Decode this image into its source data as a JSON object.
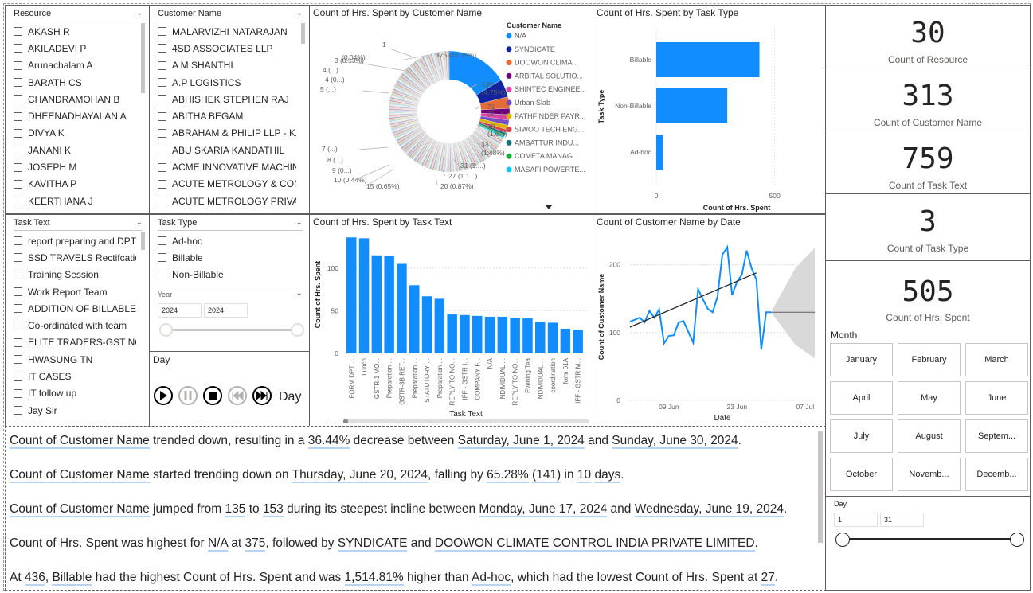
{
  "slicers": {
    "resource": {
      "title": "Resource",
      "items": [
        "AKASH R",
        "AKILADEVI P",
        "Arunachalam A",
        "BARATH CS",
        "CHANDRAMOHAN B",
        "DHEENADHAYALAN A",
        "DIVYA K",
        "JANANI K",
        "JOSEPH M",
        "KAVITHA P",
        "KEERTHANA J"
      ]
    },
    "customer": {
      "title": "Customer Name",
      "items": [
        "MALARVIZHI NATARAJAN",
        "4SD ASSOCIATES LLP",
        "A M SHANTHI",
        "A.P LOGISTICS",
        "ABHISHEK STEPHEN RAJ",
        "ABITHA BEGAM",
        "ABRAHAM & PHILIP LLP - KA",
        "ABU SKARIA KANDATHIL",
        "ACME INNOVATIVE MACHININ...",
        "ACUTE METROLOGY & CONSU...",
        "ACUTE METROLOGY PRIVATE L..."
      ]
    },
    "task_text": {
      "title": "Task Text",
      "items": [
        "report preparing and DPT ...",
        "SSD TRAVELS Rectifcation",
        "Training Session",
        "Work Report Team",
        "ADDITION OF BILLABLE JO...",
        "Co-ordinated with team",
        "ELITE TRADERS-GST NOTI...",
        "HWASUNG TN",
        "IT CASES",
        "IT follow up",
        "Jay Sir"
      ]
    },
    "task_type": {
      "title": "Task Type",
      "items": [
        "Ad-hoc",
        "Billable",
        "Non-Billable"
      ]
    },
    "year": {
      "title": "Year",
      "from": "2024",
      "to": "2024"
    },
    "day_play": {
      "title": "Day",
      "label": "Day"
    },
    "month": {
      "title": "Month",
      "items": [
        "January",
        "February",
        "March",
        "April",
        "May",
        "June",
        "July",
        "August",
        "Septem...",
        "October",
        "Novemb...",
        "Decemb..."
      ]
    },
    "day_range": {
      "title": "Day",
      "from": "1",
      "to": "31"
    }
  },
  "kpis": [
    {
      "value": "30",
      "label": "Count of Resource"
    },
    {
      "value": "313",
      "label": "Count of Customer Name"
    },
    {
      "value": "759",
      "label": "Count of Task Text"
    },
    {
      "value": "3",
      "label": "Count of Task Type"
    },
    {
      "value": "505",
      "label": "Count of Hrs. Spent"
    }
  ],
  "donut": {
    "title": "Count of Hrs. Spent by Customer Name",
    "legend_title": "Customer Name",
    "legend": [
      {
        "name": "N/A",
        "color": "#118DFF"
      },
      {
        "name": "SYNDICATE",
        "color": "#12239E"
      },
      {
        "name": "DOOWON CLIMA...",
        "color": "#E66C37"
      },
      {
        "name": "ARBITAL SOLUTIO...",
        "color": "#6B007B"
      },
      {
        "name": "SHINTEC ENGINEE...",
        "color": "#E044A7"
      },
      {
        "name": "Urban Slab",
        "color": "#744EC2"
      },
      {
        "name": "PATHFINDER PAYR...",
        "color": "#D9B300"
      },
      {
        "name": "SIWOO TECH ENG...",
        "color": "#D64550"
      },
      {
        "name": "AMBATTUR INDU...",
        "color": "#197278"
      },
      {
        "name": "COMETA MANAG...",
        "color": "#1AAB40"
      },
      {
        "name": "MASAFI POWERTE...",
        "color": "#15C6F4"
      }
    ],
    "labels": [
      "375 (16.35%)",
      "109",
      "(4.75%)",
      "71",
      "(3....)",
      "38",
      "(1.6...)",
      "34",
      "(1.48%)",
      "31 (1....)",
      "27 (1.1...)",
      "20 (0.87%)",
      "15 (0.65%)",
      "10 (0.44%)",
      "9 (0...)",
      "8 (...)",
      "7 (...)",
      "5 (...)",
      "4 (0...)",
      "4 (...)",
      "3 (0.13%)",
      "(0.04%)",
      "1"
    ]
  },
  "task_type_chart": {
    "title": "Count of Hrs. Spent by Task Type",
    "ylabel": "Task Type",
    "xlabel": "Count of Hrs. Spent",
    "ticks": [
      "0",
      "500"
    ]
  },
  "task_text_chart": {
    "title": "Count of Hrs. Spent by Task Text",
    "ylabel": "Count of Hrs. Spent",
    "xlabel": "Task Text",
    "yticks": [
      "0",
      "50",
      "100"
    ]
  },
  "date_chart": {
    "title": "Count of Customer Name by Date",
    "ylabel": "Count of Customer Name",
    "xlabel": "Date",
    "yticks": [
      "0",
      "100",
      "200"
    ],
    "xticks": [
      "09 Jun",
      "23 Jun",
      "07 Jul"
    ]
  },
  "chart_data": [
    {
      "type": "pie",
      "title": "Count of Hrs. Spent by Customer Name",
      "legend_title": "Customer Name",
      "slices": [
        {
          "label": "N/A",
          "value": 375
        },
        {
          "label": "SYNDICATE",
          "value": 109
        },
        {
          "label": "DOOWON CLIMA...",
          "value": 71
        },
        {
          "label": "ARBITAL SOLUTIO...",
          "value": 38
        },
        {
          "label": "SHINTEC ENGINEE...",
          "value": 34
        },
        {
          "label": "Urban Slab",
          "value": 31
        },
        {
          "label": "PATHFINDER PAYR...",
          "value": 27
        },
        {
          "label": "SIWOO TECH ENG...",
          "value": 20
        },
        {
          "label": "AMBATTUR INDU...",
          "value": 15
        },
        {
          "label": "COMETA MANAG...",
          "value": 10
        },
        {
          "label": "MASAFI POWERTE...",
          "value": 9
        }
      ],
      "other_value": 1554
    },
    {
      "type": "bar",
      "orientation": "horizontal",
      "title": "Count of Hrs. Spent by Task Type",
      "categories": [
        "Billable",
        "Non-Billable",
        "Ad-hoc"
      ],
      "values": [
        436,
        300,
        27
      ],
      "xlabel": "Count of Hrs. Spent",
      "ylabel": "Task Type",
      "xlim": [
        0,
        600
      ]
    },
    {
      "type": "bar",
      "title": "Count of Hrs. Spent by Task Text",
      "categories": [
        "FORM DPT ...",
        "Lunch",
        "GSTR-1 MO...",
        "Preparation ...",
        "GSTR-3B RET...",
        "Preparation ...",
        "STATUTORY ...",
        "Preparation ...",
        "REPLY TO NO...",
        "IFF - GSTR I...",
        "COMPANY F...",
        "N/A",
        "INDIVIDUAL ...",
        "REPLY TO NO...",
        "Evening Tea",
        "INDIVIDUAL ...",
        "coordination",
        "form 61A",
        "IFF - GSTR M..."
      ],
      "values": [
        136,
        135,
        115,
        114,
        105,
        80,
        67,
        64,
        46,
        45,
        44,
        43,
        43,
        42,
        41,
        37,
        36,
        29,
        28
      ],
      "ylabel": "Count of Hrs. Spent",
      "xlabel": "Task Text",
      "ylim": [
        0,
        140
      ]
    },
    {
      "type": "line",
      "title": "Count of Customer Name by Date",
      "x": [
        "Jun 1",
        "Jun 2",
        "Jun 3",
        "Jun 4",
        "Jun 5",
        "Jun 6",
        "Jun 7",
        "Jun 8",
        "Jun 9",
        "Jun 10",
        "Jun 11",
        "Jun 12",
        "Jun 13",
        "Jun 14",
        "Jun 15",
        "Jun 16",
        "Jun 17",
        "Jun 18",
        "Jun 19",
        "Jun 20",
        "Jun 21",
        "Jun 22",
        "Jun 23",
        "Jun 24",
        "Jun 25",
        "Jun 26",
        "Jun 27",
        "Jun 28",
        "Jun 29",
        "Jun 30"
      ],
      "y": [
        116,
        119,
        122,
        115,
        132,
        122,
        134,
        84,
        95,
        96,
        115,
        117,
        101,
        85,
        164,
        149,
        135,
        130,
        153,
        215,
        226,
        155,
        175,
        185,
        221,
        195,
        178,
        75,
        130,
        130
      ],
      "trend": [
        108,
        188
      ],
      "forecast": {
        "value": 130,
        "upper": 225,
        "lower": 62
      },
      "ylabel": "Count of Customer Name",
      "xlabel": "Date",
      "ylim": [
        0,
        250
      ]
    }
  ],
  "narrative": [
    [
      {
        "t": "Count of Customer Name"
      },
      {
        "t": " trended down, resulting in a "
      },
      {
        "t": "36.44%"
      },
      {
        "t": " decrease between "
      },
      {
        "t": "Saturday, June 1, 2024"
      },
      {
        "t": " and "
      },
      {
        "t": "Sunday, June 30, 2024"
      },
      {
        "t": "."
      }
    ],
    [
      {
        "t": "Count of Customer Name"
      },
      {
        "t": " started trending down on "
      },
      {
        "t": "Thursday, June 20, 2024"
      },
      {
        "t": ", falling by "
      },
      {
        "t": "65.28%"
      },
      {
        "t": " "
      },
      {
        "t": "(141)"
      },
      {
        "t": " in "
      },
      {
        "t": "10"
      },
      {
        "t": " "
      },
      {
        "t": "days"
      },
      {
        "t": "."
      }
    ],
    [
      {
        "t": "Count of Customer Name"
      },
      {
        "t": " jumped from "
      },
      {
        "t": "135"
      },
      {
        "t": " to "
      },
      {
        "t": "153"
      },
      {
        "t": " during its steepest incline between "
      },
      {
        "t": "Monday, June 17, 2024"
      },
      {
        "t": " and "
      },
      {
        "t": "Wednesday, June 19, 2024"
      },
      {
        "t": "."
      }
    ],
    [
      {
        "t": "Count of Hrs. Spent was highest for "
      },
      {
        "t": "N/A"
      },
      {
        "t": " at "
      },
      {
        "t": "375"
      },
      {
        "t": ", followed by "
      },
      {
        "t": "SYNDICATE"
      },
      {
        "t": " and "
      },
      {
        "t": "DOOWON CLIMATE CONTROL INDIA  PRIVATE LIMITED"
      },
      {
        "t": "."
      }
    ],
    [
      {
        "t": "At "
      },
      {
        "t": "436"
      },
      {
        "t": ", "
      },
      {
        "t": "Billable"
      },
      {
        "t": " had the highest Count of Hrs. Spent and was "
      },
      {
        "t": "1,514.81%"
      },
      {
        "t": " higher than "
      },
      {
        "t": "Ad-hoc"
      },
      {
        "t": ", which had the lowest Count of Hrs. Spent at "
      },
      {
        "t": "27"
      },
      {
        "t": "."
      }
    ]
  ],
  "narrative_underlined": [
    [
      0,
      2,
      4,
      6
    ],
    [
      0,
      2,
      4,
      6,
      8,
      10
    ],
    [
      0,
      2,
      4,
      6,
      8
    ],
    [
      1,
      3,
      5,
      7
    ],
    [
      1,
      3,
      5,
      7,
      9
    ]
  ],
  "colors": {
    "accent": "#118DFF",
    "trend": "#252423",
    "forecast_band": "#d9d9d9"
  }
}
